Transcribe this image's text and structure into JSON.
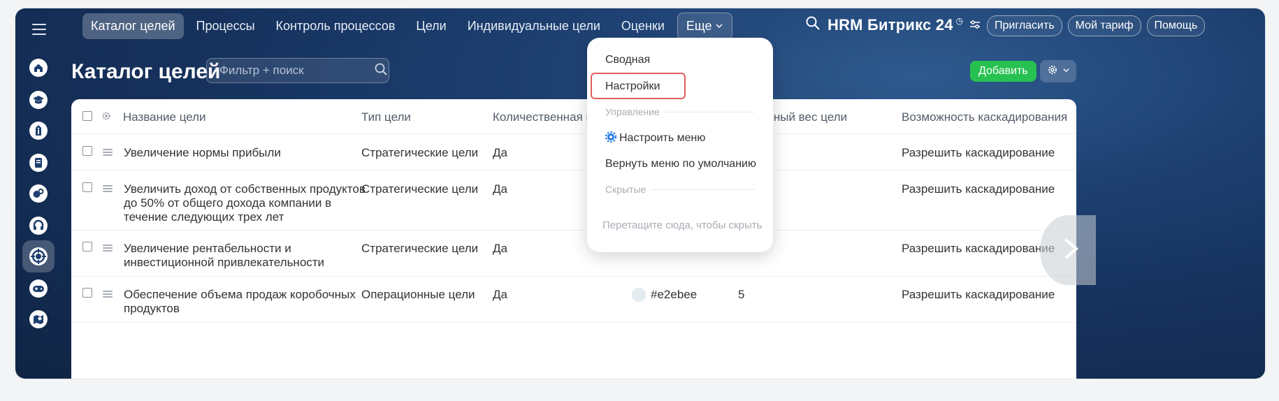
{
  "nav": {
    "items": [
      "Каталог целей",
      "Процессы",
      "Контроль процессов",
      "Цели",
      "Индивидуальные цели",
      "Оценки"
    ],
    "more_label": "Еще"
  },
  "brand": {
    "text": "HRM Битрикс 24",
    "clock": "◷"
  },
  "top_actions": {
    "invite": "Пригласить",
    "tariff": "Мой тариф",
    "help": "Помощь"
  },
  "page": {
    "title": "Каталог целей"
  },
  "filter": {
    "placeholder": "Фильтр + поиск",
    "value": ""
  },
  "add_button": "Добавить",
  "table": {
    "headers": [
      "Название цели",
      "Тип цели",
      "Количественная цел",
      "ьный вес цели",
      "Возможность каскадирования"
    ],
    "rows": [
      {
        "name": [
          "Увеличение нормы прибыли"
        ],
        "type": "Стратегические цели",
        "quant": "Да",
        "color": "",
        "weight": "",
        "cascade": "Разрешить каскадирование"
      },
      {
        "name": [
          "Увеличить доход от собственных продуктов",
          "до 50% от общего дохода компании в",
          "течение следующих трех лет"
        ],
        "type": "Стратегические цели",
        "quant": "Да",
        "color": "",
        "weight": "",
        "cascade": "Разрешить каскадирование"
      },
      {
        "name": [
          "Увеличение рентабельности и",
          "инвестиционной привлекательности"
        ],
        "type": "Стратегические цели",
        "quant": "Да",
        "color": "",
        "weight": "",
        "cascade": "Разрешить каскадирование"
      },
      {
        "name": [
          "Обеспечение объема продаж коробочных",
          "продуктов"
        ],
        "type": "Операционные цели",
        "quant": "Да",
        "color": "#e2ebee",
        "weight": "5",
        "cascade": "Разрешить каскадирование"
      }
    ]
  },
  "popup": {
    "summary": "Сводная",
    "settings": "Настройки",
    "section_manage": "Управление",
    "configure_menu": "Настроить меню",
    "reset_menu": "Вернуть меню по умолчанию",
    "section_hidden": "Скрытые",
    "drag_hint": "Перетащите сюда, чтобы скрыть"
  },
  "colors": {
    "accent_green": "#27c151",
    "highlight_red": "#e25c5c",
    "swatch": "#e2ebee"
  }
}
